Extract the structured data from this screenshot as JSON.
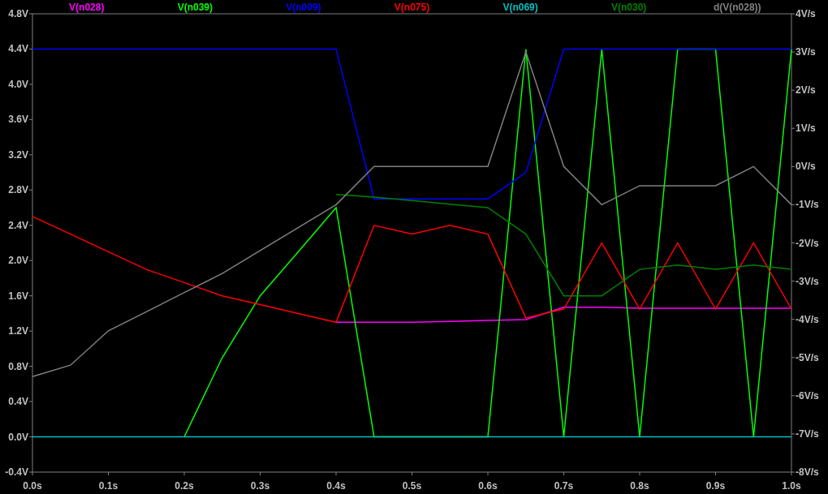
{
  "chart_data": {
    "type": "line",
    "x": [
      0,
      0.05,
      0.1,
      0.15,
      0.2,
      0.25,
      0.3,
      0.35,
      0.4,
      0.45,
      0.5,
      0.55,
      0.6,
      0.65,
      0.7,
      0.75,
      0.8,
      0.85,
      0.9,
      0.95,
      1.0
    ],
    "series": [
      {
        "name": "V(n028)",
        "color": "#ff00ff",
        "values": [
          null,
          null,
          null,
          null,
          null,
          null,
          null,
          null,
          1.3,
          1.3,
          1.3,
          1.31,
          1.32,
          1.33,
          1.47,
          1.47,
          1.46,
          1.46,
          1.46,
          1.46,
          1.46
        ]
      },
      {
        "name": "V(n039)",
        "color": "#00ff00",
        "values": [
          null,
          null,
          null,
          null,
          0,
          0.9,
          1.6,
          2.1,
          2.6,
          0,
          0,
          0,
          0,
          4.4,
          0,
          4.4,
          0,
          4.4,
          4.4,
          0,
          4.4
        ]
      },
      {
        "name": "V(n009)",
        "color": "#0000ff",
        "values": [
          4.4,
          4.4,
          4.4,
          4.4,
          4.4,
          4.4,
          4.4,
          4.4,
          4.4,
          2.7,
          2.7,
          2.7,
          2.7,
          3.0,
          4.4,
          4.4,
          4.4,
          4.4,
          4.4,
          4.4,
          4.4
        ]
      },
      {
        "name": "V(n075)",
        "color": "#ff0000",
        "values": [
          2.5,
          2.3,
          2.1,
          1.9,
          1.75,
          1.6,
          1.5,
          1.4,
          1.3,
          2.4,
          2.3,
          2.4,
          2.3,
          1.35,
          1.45,
          2.2,
          1.45,
          2.2,
          1.45,
          2.2,
          1.45
        ]
      },
      {
        "name": "V(n069)",
        "color": "#00bfbf",
        "values": [
          0,
          0,
          0,
          0,
          0,
          0,
          0,
          0,
          0,
          0,
          0,
          0,
          0,
          0,
          0,
          0,
          0,
          0,
          0,
          0,
          0
        ]
      },
      {
        "name": "V(n030)",
        "color": "#008000",
        "values": [
          null,
          null,
          null,
          null,
          null,
          null,
          null,
          null,
          2.75,
          2.72,
          2.68,
          2.64,
          2.6,
          2.3,
          1.6,
          1.6,
          1.9,
          1.95,
          1.9,
          1.95,
          1.9
        ]
      },
      {
        "name": "d(V(n028))",
        "color": "#808080",
        "axis": "y2",
        "values": [
          -5.5,
          -5.2,
          -4.3,
          -3.8,
          -3.3,
          -2.8,
          -2.2,
          -1.6,
          -1.0,
          0,
          0,
          0,
          0,
          3,
          0,
          -1,
          -0.5,
          -0.5,
          -0.5,
          0,
          -1
        ]
      }
    ],
    "xlim": [
      0,
      1
    ],
    "ylim": [
      -0.4,
      4.8
    ],
    "y2lim": [
      -8,
      4
    ],
    "xticks": [
      {
        "value": 0,
        "label": "0.0s"
      },
      {
        "value": 0.1,
        "label": "0.1s"
      },
      {
        "value": 0.2,
        "label": "0.2s"
      },
      {
        "value": 0.3,
        "label": "0.3s"
      },
      {
        "value": 0.4,
        "label": "0.4s"
      },
      {
        "value": 0.5,
        "label": "0.5s"
      },
      {
        "value": 0.6,
        "label": "0.6s"
      },
      {
        "value": 0.7,
        "label": "0.7s"
      },
      {
        "value": 0.8,
        "label": "0.8s"
      },
      {
        "value": 0.9,
        "label": "0.9s"
      },
      {
        "value": 1.0,
        "label": "1.0s"
      }
    ],
    "yticks": [
      {
        "value": 4.8,
        "label": "4.8V"
      },
      {
        "value": 4.4,
        "label": "4.4V"
      },
      {
        "value": 4.0,
        "label": "4.0V"
      },
      {
        "value": 3.6,
        "label": "3.6V"
      },
      {
        "value": 3.2,
        "label": "3.2V"
      },
      {
        "value": 2.8,
        "label": "2.8V"
      },
      {
        "value": 2.4,
        "label": "2.4V"
      },
      {
        "value": 2.0,
        "label": "2.0V"
      },
      {
        "value": 1.6,
        "label": "1.6V"
      },
      {
        "value": 1.2,
        "label": "1.2V"
      },
      {
        "value": 0.8,
        "label": "0.8V"
      },
      {
        "value": 0.4,
        "label": "0.4V"
      },
      {
        "value": 0.0,
        "label": "0.0V"
      },
      {
        "value": -0.4,
        "label": "-0.4V"
      }
    ],
    "y2ticks": [
      {
        "value": 4,
        "label": "4V/s"
      },
      {
        "value": 3,
        "label": "3V/s"
      },
      {
        "value": 2,
        "label": "2V/s"
      },
      {
        "value": 1,
        "label": "1V/s"
      },
      {
        "value": 0,
        "label": "0V/s"
      },
      {
        "value": -1,
        "label": "-1V/s"
      },
      {
        "value": -2,
        "label": "-2V/s"
      },
      {
        "value": -3,
        "label": "-3V/s"
      },
      {
        "value": -4,
        "label": "-4V/s"
      },
      {
        "value": -5,
        "label": "-5V/s"
      },
      {
        "value": -6,
        "label": "-6V/s"
      },
      {
        "value": -7,
        "label": "-7V/s"
      },
      {
        "value": -8,
        "label": "-8V/s"
      }
    ]
  }
}
